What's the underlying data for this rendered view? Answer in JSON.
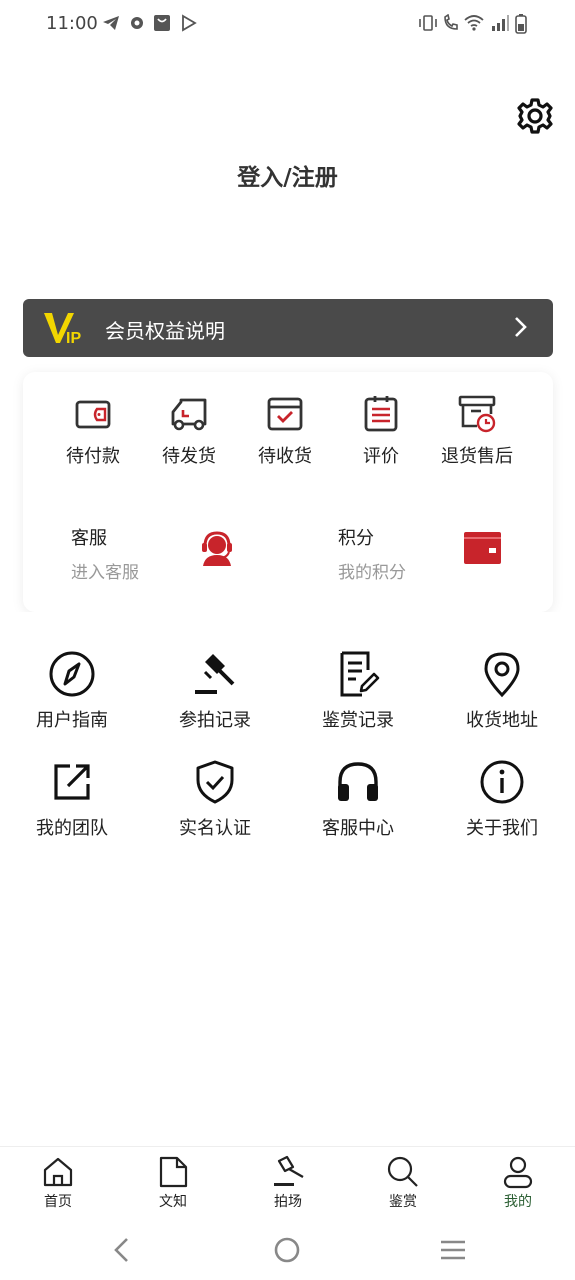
{
  "status_bar": {
    "time": "11:00"
  },
  "header": {
    "login_text": "登入/注册"
  },
  "vip_bar": {
    "logo_text": "VIP",
    "label": "会员权益说明"
  },
  "order_card": {
    "items": [
      {
        "label": "待付款",
        "icon": "wallet-icon"
      },
      {
        "label": "待发货",
        "icon": "truck-icon"
      },
      {
        "label": "待收货",
        "icon": "package-check-icon"
      },
      {
        "label": "评价",
        "icon": "clipboard-list-icon"
      },
      {
        "label": "退货售后",
        "icon": "return-box-clock-icon"
      }
    ],
    "customer_service": {
      "title": "客服",
      "subtitle": "进入客服",
      "icon": "headset-agent-icon"
    },
    "points": {
      "title": "积分",
      "subtitle": "我的积分",
      "icon": "red-wallet-icon"
    }
  },
  "menu_grid": {
    "items": [
      {
        "label": "用户指南",
        "icon": "compass-icon"
      },
      {
        "label": "参拍记录",
        "icon": "gavel-icon"
      },
      {
        "label": "鉴赏记录",
        "icon": "document-edit-icon"
      },
      {
        "label": "收货地址",
        "icon": "location-pin-icon"
      },
      {
        "label": "我的团队",
        "icon": "share-external-icon"
      },
      {
        "label": "实名认证",
        "icon": "shield-check-icon"
      },
      {
        "label": "客服中心",
        "icon": "headphones-icon"
      },
      {
        "label": "关于我们",
        "icon": "info-icon"
      }
    ]
  },
  "bottom_nav": {
    "items": [
      {
        "label": "首页",
        "icon": "home-icon"
      },
      {
        "label": "文知",
        "icon": "document-icon"
      },
      {
        "label": "拍场",
        "icon": "gavel-icon"
      },
      {
        "label": "鉴赏",
        "icon": "search-icon"
      },
      {
        "label": "我的",
        "icon": "user-icon"
      }
    ],
    "active_index": 4,
    "active_color": "#2a5e32"
  },
  "colors": {
    "accent_red": "#c8242b",
    "vip_bar_bg": "#4a4a4a",
    "vip_yellow": "#f2d600"
  }
}
